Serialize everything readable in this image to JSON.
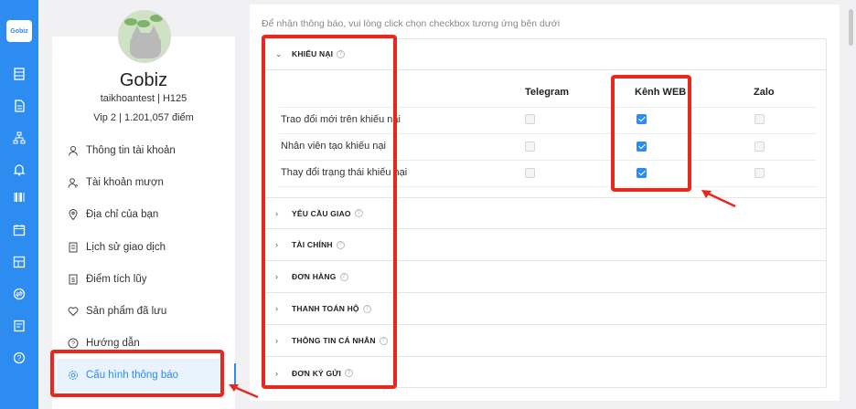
{
  "rail": {
    "logo": "Gobiz",
    "icons": [
      "document-icon",
      "file-icon",
      "sitemap-icon",
      "bell-icon",
      "barcode-icon",
      "calendar-icon",
      "layout-icon",
      "exchange-icon",
      "report-icon",
      "help-icon"
    ]
  },
  "profile": {
    "name": "Gobiz",
    "account": "taikhoantest | H125",
    "vip": "Vip 2 | 1.201,057 điểm"
  },
  "menu": [
    {
      "label": "Thông tin tài khoản",
      "icon": "user-icon"
    },
    {
      "label": "Tài khoản mượn",
      "icon": "user-group-icon"
    },
    {
      "label": "Địa chỉ của bạn",
      "icon": "location-icon"
    },
    {
      "label": "Lịch sử giao dịch",
      "icon": "history-icon"
    },
    {
      "label": "Điểm tích lũy",
      "icon": "points-icon"
    },
    {
      "label": "Sản phẩm đã lưu",
      "icon": "heart-icon"
    },
    {
      "label": "Hướng dẫn",
      "icon": "question-icon"
    },
    {
      "label": "Cấu hình thông báo",
      "icon": "settings-icon"
    }
  ],
  "main": {
    "hint": "Để nhận thông báo, vui lòng click chọn checkbox tương ứng bên dưới",
    "expanded_section": "KHIẾU NẠI",
    "columns": [
      "Telegram",
      "Kênh WEB",
      "Zalo"
    ],
    "rows": [
      {
        "label": "Trao đổi mới trên khiếu nại",
        "telegram": false,
        "web": true,
        "zalo": false
      },
      {
        "label": "Nhân viên tạo khiếu nại",
        "telegram": false,
        "web": true,
        "zalo": false
      },
      {
        "label": "Thay đổi trạng thái khiếu nại",
        "telegram": false,
        "web": true,
        "zalo": false
      }
    ],
    "collapsed_sections": [
      "YÊU CẦU GIAO",
      "TÀI CHÍNH",
      "ĐƠN HÀNG",
      "THANH TOÁN HỘ",
      "THÔNG TIN CÁ NHÂN",
      "ĐƠN KÝ GỬI"
    ]
  },
  "colors": {
    "accent": "#2d8cf0",
    "annotation": "#e8281e"
  }
}
